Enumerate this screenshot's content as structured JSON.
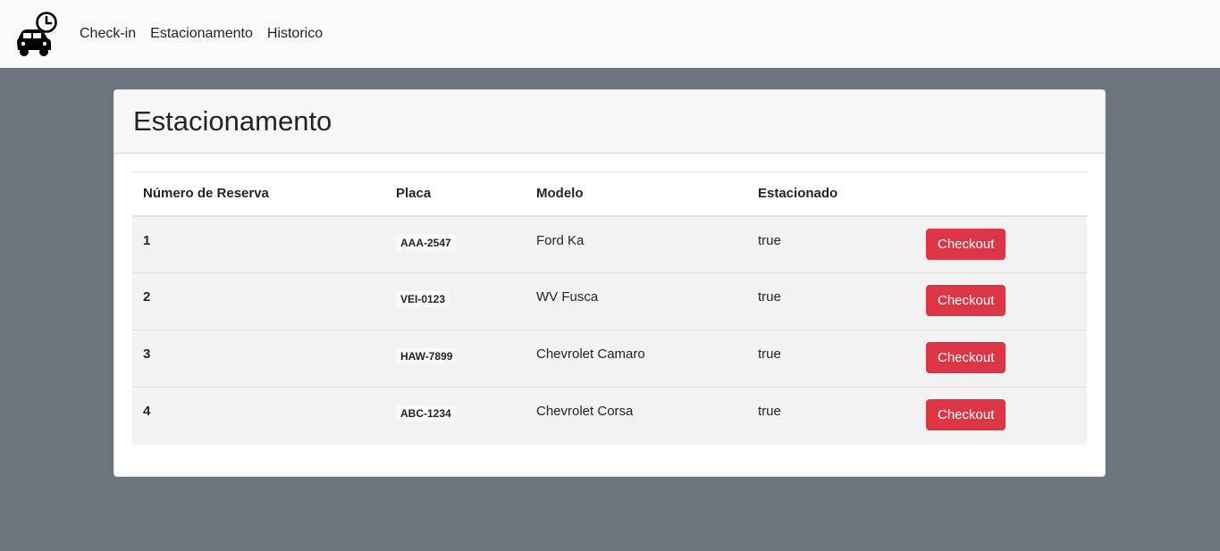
{
  "navbar": {
    "logo_icon": "car-clock-icon",
    "links": [
      {
        "label": "Check-in"
      },
      {
        "label": "Estacionamento"
      },
      {
        "label": "Historico"
      }
    ]
  },
  "card": {
    "title": "Estacionamento"
  },
  "table": {
    "headers": [
      "Número de Reserva",
      "Placa",
      "Modelo",
      "Estacionado",
      ""
    ],
    "rows": [
      {
        "id": "1",
        "placa": "AAA-2547",
        "modelo": "Ford Ka",
        "estacionado": "true",
        "action": "Checkout"
      },
      {
        "id": "2",
        "placa": "VEI-0123",
        "modelo": "WV Fusca",
        "estacionado": "true",
        "action": "Checkout"
      },
      {
        "id": "3",
        "placa": "HAW-7899",
        "modelo": "Chevrolet Camaro",
        "estacionado": "true",
        "action": "Checkout"
      },
      {
        "id": "4",
        "placa": "ABC-1234",
        "modelo": "Chevrolet Corsa",
        "estacionado": "true",
        "action": "Checkout"
      }
    ]
  },
  "colors": {
    "page_background": "#6c757d",
    "navbar_background": "#f8f9fa",
    "danger_button": "#dc3545",
    "striped_row": "#f2f2f2"
  }
}
